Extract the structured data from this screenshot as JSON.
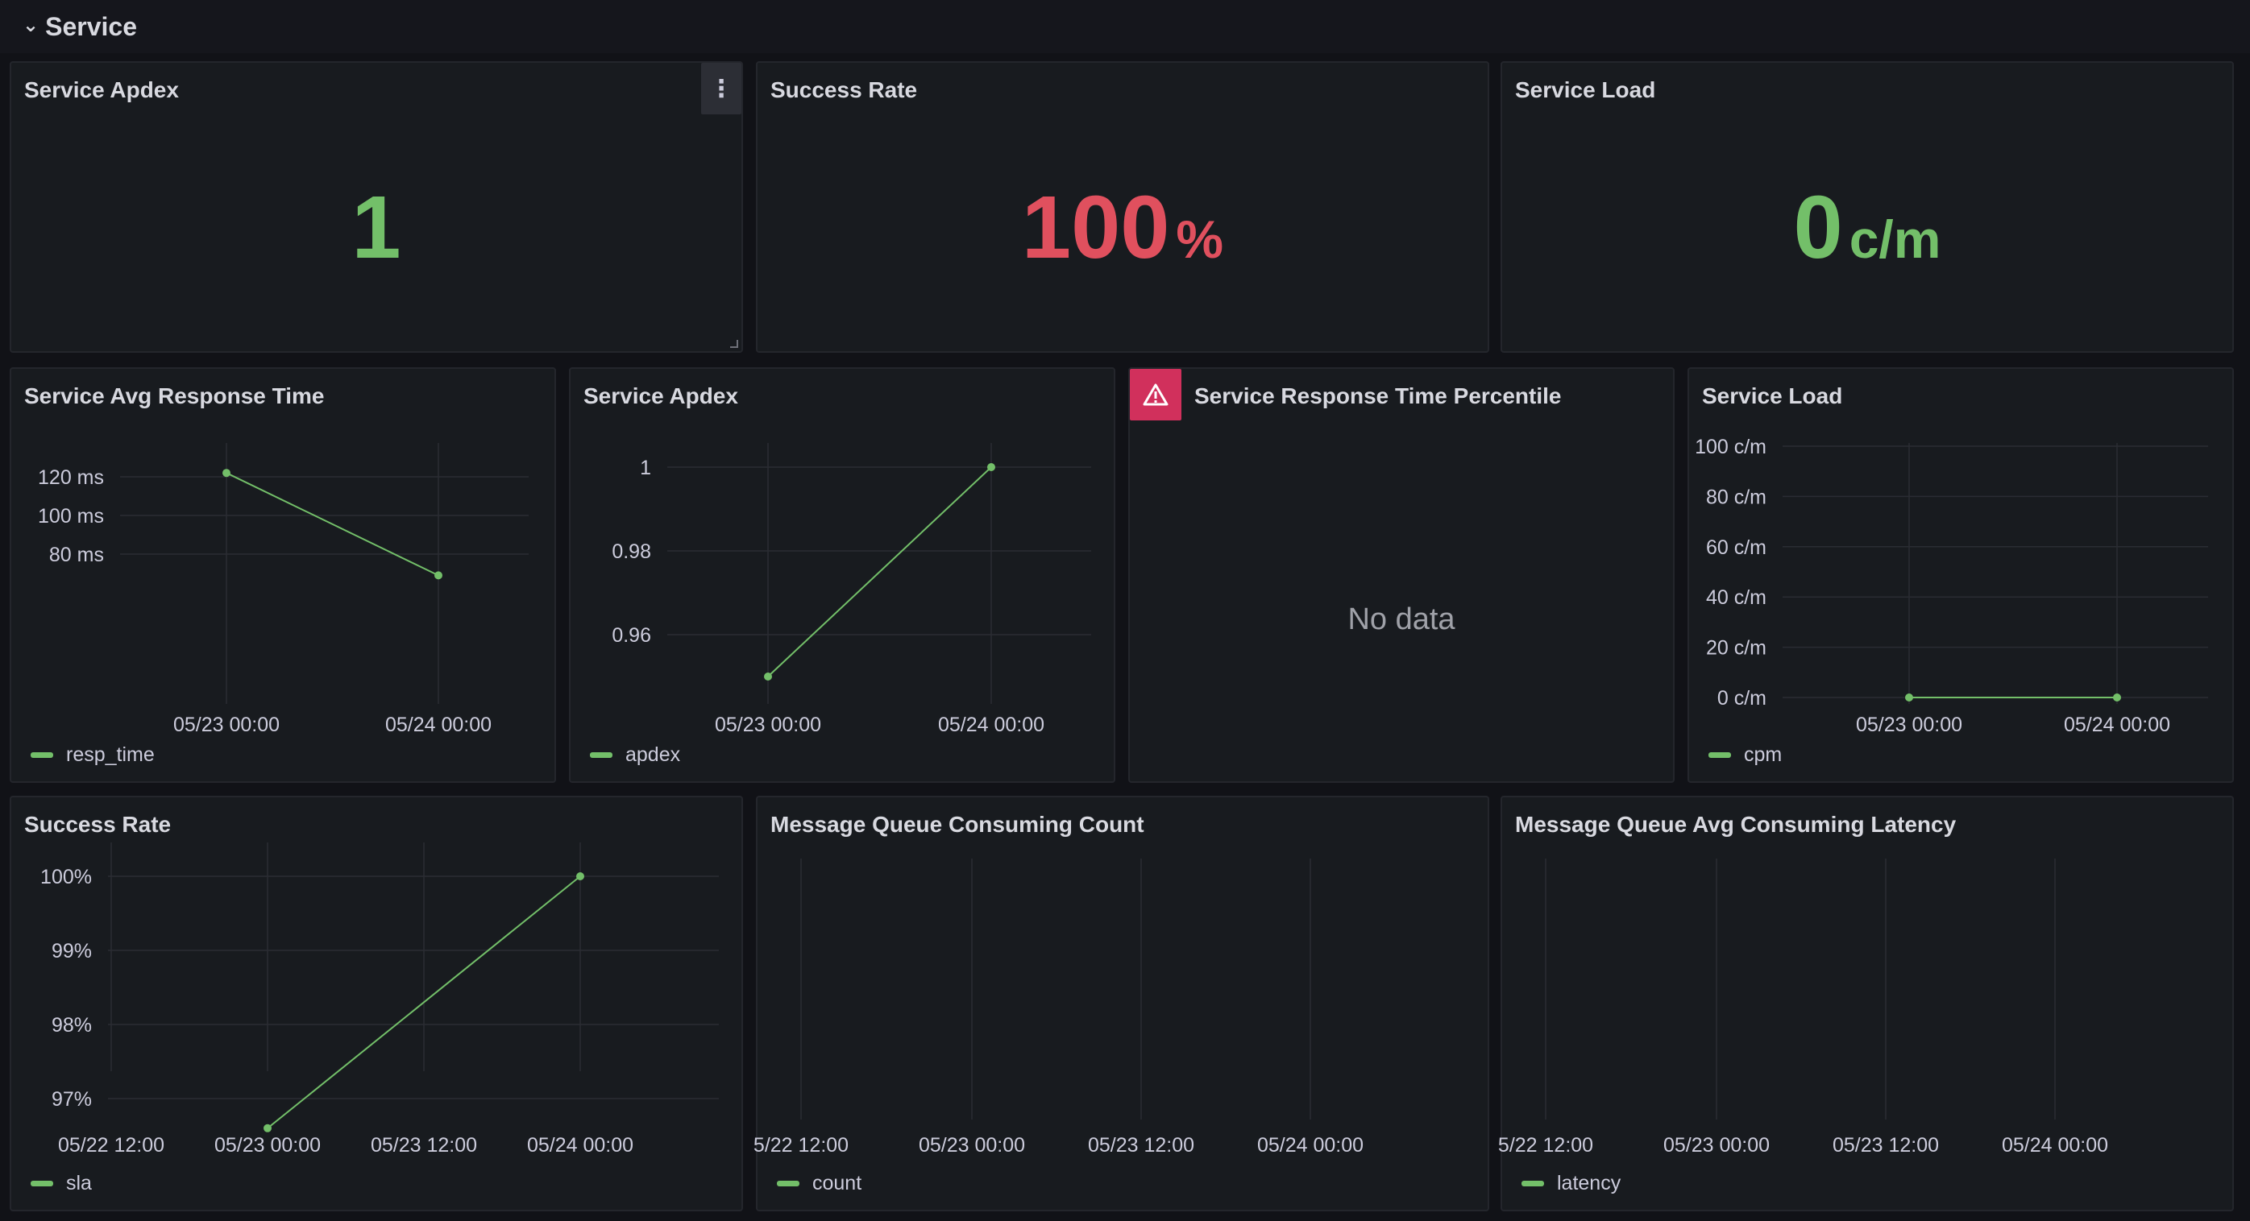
{
  "row": {
    "title": "Service",
    "chevron": "chevron-down-icon"
  },
  "colors": {
    "green": "#73bf69",
    "red": "#f2495c",
    "warn": "#d1305c"
  },
  "stats": {
    "apdex": {
      "title": "Service Apdex",
      "value": "1",
      "unit": "",
      "color": "#73bf69",
      "menu_icon": "more-vertical-icon"
    },
    "success": {
      "title": "Success Rate",
      "value": "100",
      "unit": "%",
      "color": "#e0505e"
    },
    "load": {
      "title": "Service Load",
      "value": "0",
      "unit": "c/m",
      "color": "#73bf69"
    }
  },
  "charts": {
    "resp": {
      "title": "Service Avg Response Time",
      "legend": "resp_time",
      "chart_data": {
        "type": "line",
        "x": [
          "05/23 00:00",
          "05/24 00:00"
        ],
        "series": [
          {
            "name": "resp_time",
            "values": [
              122,
              69
            ]
          }
        ],
        "yticks": [
          "120 ms",
          "100 ms",
          "80 ms"
        ],
        "ytick_values": [
          120,
          100,
          80
        ],
        "xticks": [
          "05/23 00:00",
          "05/24 00:00"
        ],
        "ylim": [
          64,
          130
        ]
      }
    },
    "apdex": {
      "title": "Service Apdex",
      "legend": "apdex",
      "chart_data": {
        "type": "line",
        "x": [
          "05/23 00:00",
          "05/24 00:00"
        ],
        "series": [
          {
            "name": "apdex",
            "values": [
              0.95,
              1
            ]
          }
        ],
        "yticks": [
          "1",
          "0.98",
          "0.96"
        ],
        "ytick_values": [
          1,
          0.98,
          0.96
        ],
        "xticks": [
          "05/23 00:00",
          "05/24 00:00"
        ],
        "ylim": [
          0.945,
          1.004
        ]
      }
    },
    "percentile": {
      "title": "Service Response Time Percentile",
      "no_data": "No data",
      "warn_icon": "warning-icon"
    },
    "load": {
      "title": "Service Load",
      "legend": "cpm",
      "chart_data": {
        "type": "line",
        "x": [
          "05/23 00:00",
          "05/24 00:00"
        ],
        "series": [
          {
            "name": "cpm",
            "values": [
              0,
              0
            ]
          }
        ],
        "yticks": [
          "100 c/m",
          "80 c/m",
          "60 c/m",
          "40 c/m",
          "20 c/m",
          "0 c/m"
        ],
        "ytick_values": [
          100,
          80,
          60,
          40,
          20,
          0
        ],
        "xticks": [
          "05/23 00:00",
          "05/24 00:00"
        ],
        "ylim": [
          0,
          100
        ]
      }
    },
    "sla": {
      "title": "Success Rate",
      "legend": "sla",
      "chart_data": {
        "type": "line",
        "x": [
          "05/23 00:00",
          "05/24 00:00"
        ],
        "series": [
          {
            "name": "sla",
            "values": [
              96.6,
              100
            ]
          }
        ],
        "yticks": [
          "100%",
          "99%",
          "98%",
          "97%"
        ],
        "ytick_values": [
          100,
          99,
          98,
          97
        ],
        "xticks": [
          "05/22 12:00",
          "05/23 00:00",
          "05/23 12:00",
          "05/24 00:00"
        ],
        "ylim": [
          96.2,
          100.2
        ]
      }
    },
    "mqcount": {
      "title": "Message Queue Consuming Count",
      "legend": "count",
      "chart_data": {
        "type": "line",
        "series": [
          {
            "name": "count",
            "values": []
          }
        ],
        "yticks": [],
        "xticks": [
          "5/22 12:00",
          "05/23 00:00",
          "05/23 12:00",
          "05/24 00:00"
        ]
      }
    },
    "mqlatency": {
      "title": "Message Queue Avg Consuming Latency",
      "legend": "latency",
      "chart_data": {
        "type": "line",
        "series": [
          {
            "name": "latency",
            "values": []
          }
        ],
        "yticks": [],
        "xticks": [
          "5/22 12:00",
          "05/23 00:00",
          "05/23 12:00",
          "05/24 00:00"
        ]
      }
    }
  }
}
